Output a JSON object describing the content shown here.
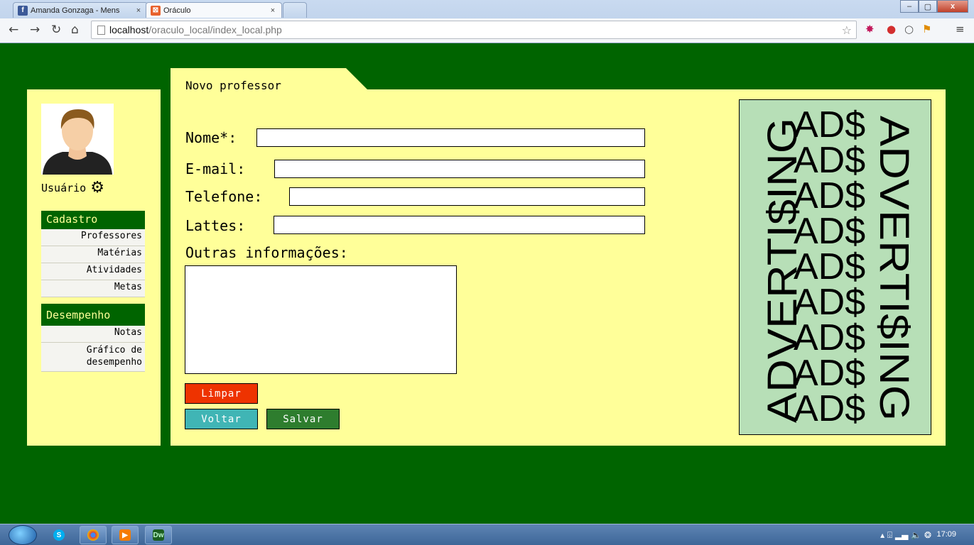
{
  "browser": {
    "tabs": [
      {
        "label": "Amanda Gonzaga - Mens",
        "close": "×"
      },
      {
        "label": "Oráculo",
        "close": "×"
      }
    ],
    "url_host": "localhost",
    "url_path": "/oraculo_local/index_local.php",
    "window_buttons": {
      "minimize": "–",
      "maximize": "▢",
      "close": "x"
    }
  },
  "sidebar": {
    "user_label": "Usuário",
    "cadastro": {
      "header": "Cadastro",
      "items": [
        "Professores",
        "Matérias",
        "Atividades",
        "Metas"
      ]
    },
    "desempenho": {
      "header": "Desempenho",
      "items": [
        "Notas",
        "Gráfico de desempenho"
      ]
    }
  },
  "form": {
    "tab_title": "Novo professor",
    "nome_label": "Nome*:",
    "email_label": "E-mail:",
    "telefone_label": "Telefone:",
    "lattes_label": "Lattes:",
    "outras_label": "Outras informações:",
    "nome_value": "",
    "email_value": "",
    "telefone_value": "",
    "lattes_value": "",
    "outras_value": "",
    "limpar": "Limpar",
    "voltar": "Voltar",
    "salvar": "Salvar"
  },
  "ad": {
    "left_text": "ADVERTI$ING",
    "right_text": "ADVERTI$ING",
    "middle_text": "AD$"
  },
  "taskbar": {
    "clock": "17:09"
  },
  "colors": {
    "page_bg": "#006400",
    "panel_bg": "#ffff99",
    "ad_bg": "#b7dfb7",
    "limpar": "#ee3300",
    "voltar": "#40b5b5",
    "salvar": "#2e7d2e"
  }
}
